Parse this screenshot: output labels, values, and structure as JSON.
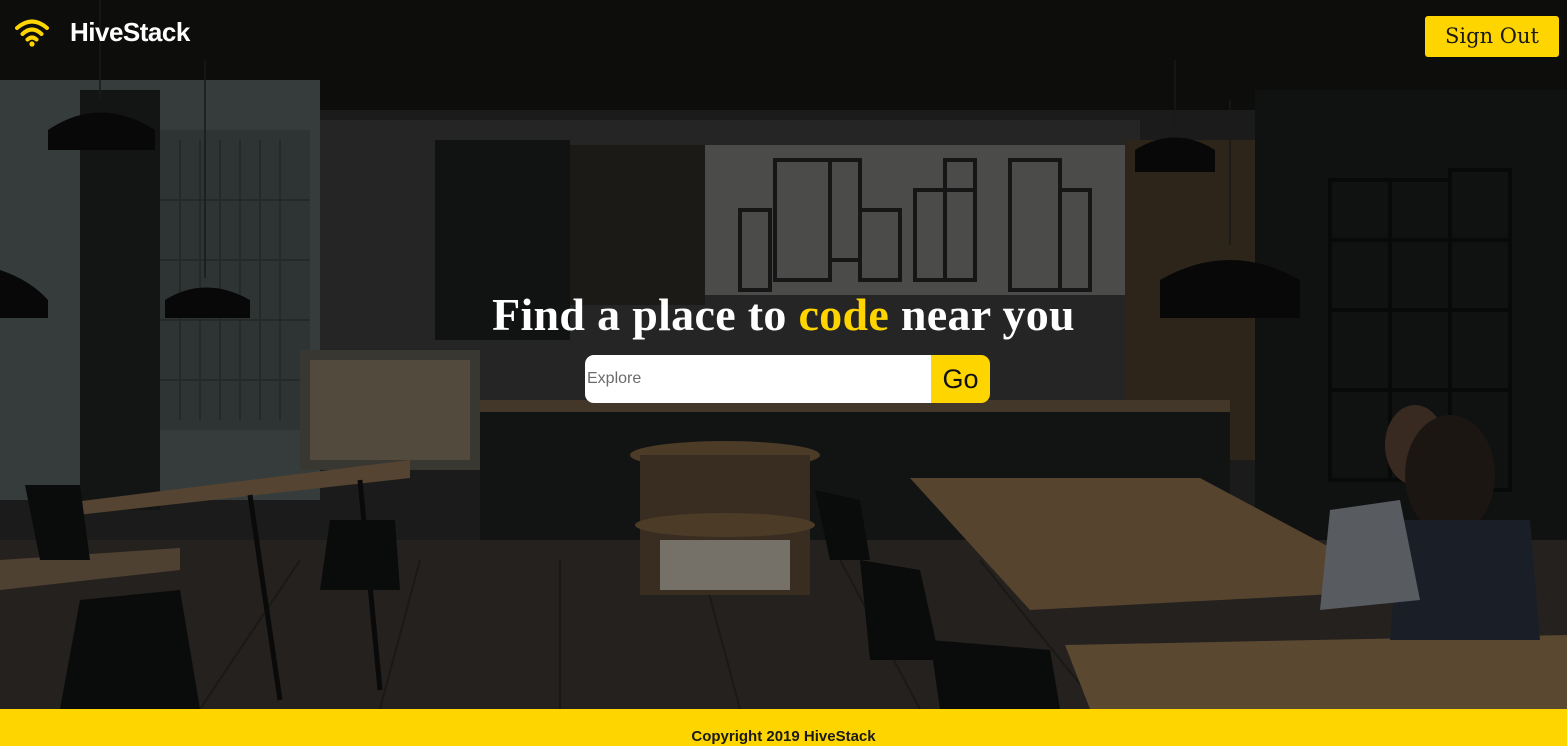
{
  "nav": {
    "brand": "HiveStack",
    "brand_icon": "wifi-icon",
    "sign_out_label": "Sign Out"
  },
  "hero": {
    "title_before": "Find a place to ",
    "title_accent": "code",
    "title_after": " near you",
    "search_placeholder": "Explore",
    "search_value": "",
    "go_label": "Go"
  },
  "footer": {
    "text": "Copyright 2019 HiveStack"
  },
  "colors": {
    "accent": "#ffd500",
    "text_light": "#ffffff",
    "overlay": "#000000"
  }
}
